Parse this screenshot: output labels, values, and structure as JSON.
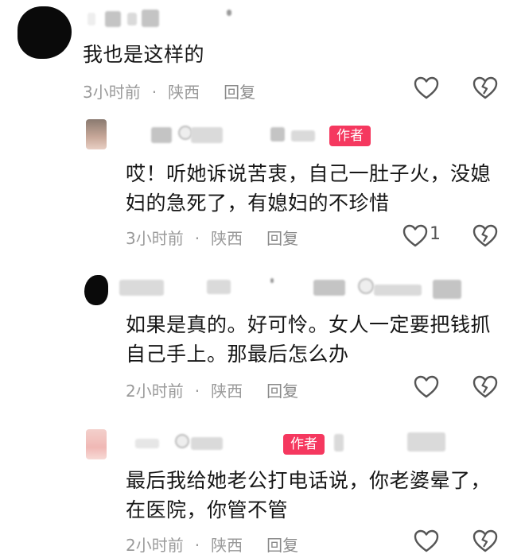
{
  "comments": [
    {
      "text": "我也是这样的",
      "time": "3小时前",
      "sep": "·",
      "location": "陕西",
      "reply": "回复",
      "is_author": false,
      "like_count": "",
      "avatar": "black-blob"
    },
    {
      "text": "哎！听她诉说苦衷，自己一肚子火，没媳妇的急死了，有媳妇的不珍惜",
      "time": "3小时前",
      "sep": "·",
      "location": "陕西",
      "reply": "回复",
      "is_author": true,
      "author_tag": "作者",
      "like_count": "1",
      "avatar": "photo"
    },
    {
      "text": "如果是真的。好可怜。女人一定要把钱抓自己手上。那最后怎么办",
      "time": "2小时前",
      "sep": "·",
      "location": "陕西",
      "reply": "回复",
      "is_author": false,
      "like_count": "",
      "avatar": "black-blob"
    },
    {
      "text": "最后我给她老公打电话说，你老婆晕了，在医院，你管不管",
      "time": "2小时前",
      "sep": "·",
      "location": "陕西",
      "reply": "回复",
      "is_author": true,
      "author_tag": "作者",
      "like_count": "",
      "avatar": "photo-pink"
    }
  ],
  "icons": {
    "like": "heart-outline-icon",
    "dislike": "broken-heart-outline-icon"
  },
  "colors": {
    "author_tag_bg": "#f5385f",
    "meta_text": "#9a9a9a",
    "icon_stroke": "#555555"
  }
}
